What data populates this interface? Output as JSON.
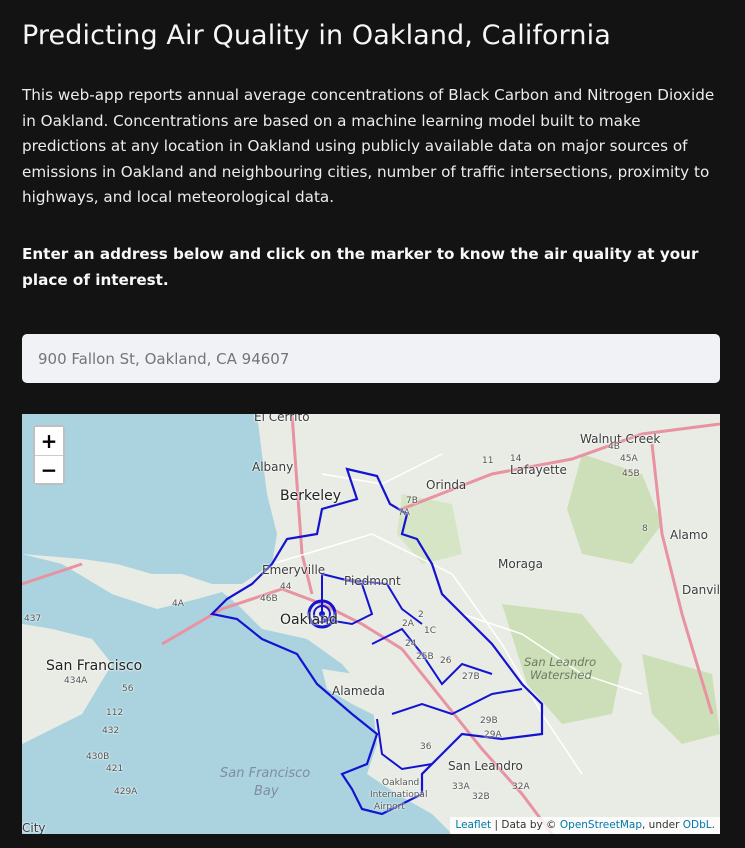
{
  "page": {
    "title": "Predicting Air Quality in Oakland, California",
    "intro": "This web-app reports annual average concentrations of Black Carbon and Nitrogen Dioxide in Oakland. Concentrations are based on a machine learning model built to make predictions at any location in Oakland using publicly available data on major sources of emissions in Oakland and neighbouring cities, number of traffic intersections, proximity to highways, and local meteorological data.",
    "instruction": "Enter an address below and click on the marker to know the air quality at your place of interest."
  },
  "address": {
    "placeholder": "900 Fallon St, Oakland, CA 94607"
  },
  "map": {
    "zoom_in_label": "+",
    "zoom_out_label": "−",
    "attribution": {
      "leaflet": "Leaflet",
      "data_by": "| Data by ©",
      "osm": "OpenStreetMap",
      "under": ", under",
      "odbl": "ODbL"
    },
    "colors": {
      "boundary": "#1414d0",
      "land": "#e9ece5",
      "water": "#aad3df",
      "park": "#cddfb8",
      "highway": "#e892a2"
    },
    "labels": {
      "el_cerrito": "El Cerrito",
      "albany": "Albany",
      "berkeley": "Berkeley",
      "emeryville": "Emeryville",
      "piedmont": "Piedmont",
      "oakland": "Oakland",
      "alameda": "Alameda",
      "san_francisco": "San Francisco",
      "san_leandro": "San Leandro",
      "orinda": "Orinda",
      "lafayette": "Lafayette",
      "walnut_creek": "Walnut Creek",
      "alamo": "Alamo",
      "moraga": "Moraga",
      "danville": "Danville",
      "daly_city": "City",
      "oakland_airport_1": "Oakland",
      "oakland_airport_2": "International",
      "oakland_airport_3": "Airport",
      "sl_watershed_1": "San Leandro",
      "sl_watershed_2": "Watershed",
      "sf_bay_1": "San Francisco",
      "sf_bay_2": "Bay"
    },
    "route_shields": [
      "437",
      "434A",
      "56",
      "112",
      "432",
      "4A",
      "46B",
      "44",
      "7B",
      "7A",
      "2",
      "1C",
      "2A",
      "24",
      "25B",
      "26",
      "27B",
      "29B",
      "29A",
      "36",
      "33A",
      "32B",
      "32A",
      "430B",
      "421",
      "429A",
      "4B",
      "45A",
      "45B",
      "8",
      "11",
      "14"
    ]
  }
}
